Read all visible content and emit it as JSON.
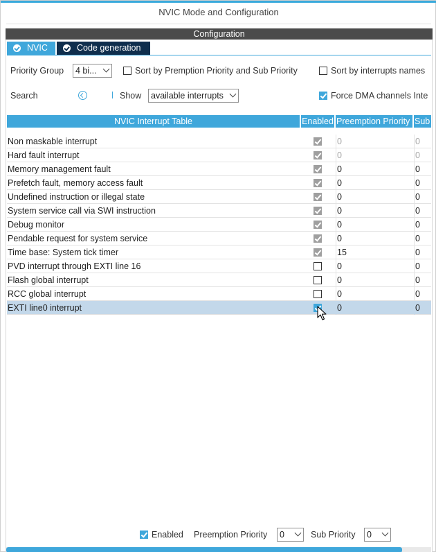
{
  "window": {
    "title": "NVIC Mode and Configuration"
  },
  "config_bar": {
    "label": "Configuration"
  },
  "tabs": [
    {
      "label": "NVIC",
      "icon": "check-circle-icon",
      "active": true
    },
    {
      "label": "Code generation",
      "icon": "check-circle-icon",
      "active": false
    }
  ],
  "toolbar": {
    "priority_group_label": "Priority Group",
    "priority_group_value": "4 bi...",
    "sort_preemption_label": "Sort by Premption Priority and Sub Priority",
    "sort_preemption_checked": false,
    "sort_interrupts_label": "Sort by interrupts names",
    "sort_interrupts_checked": false,
    "search_label": "Search",
    "show_label": "Show",
    "show_value": "available interrupts",
    "force_dma_label": "Force DMA channels Inte",
    "force_dma_checked": true
  },
  "table": {
    "headers": {
      "name": "NVIC Interrupt Table",
      "enabled": "Enabled",
      "preemption": "Preemption Priority",
      "sub": "Sub"
    },
    "rows": [
      {
        "name": "Non maskable interrupt",
        "enabled": true,
        "locked": true,
        "preemption": "0",
        "sub": "0",
        "muted": true
      },
      {
        "name": "Hard fault interrupt",
        "enabled": true,
        "locked": true,
        "preemption": "0",
        "sub": "0",
        "muted": true
      },
      {
        "name": "Memory management fault",
        "enabled": true,
        "locked": true,
        "preemption": "0",
        "sub": "0"
      },
      {
        "name": "Prefetch fault, memory access fault",
        "enabled": true,
        "locked": true,
        "preemption": "0",
        "sub": "0"
      },
      {
        "name": "Undefined instruction or illegal state",
        "enabled": true,
        "locked": true,
        "preemption": "0",
        "sub": "0"
      },
      {
        "name": "System service call via SWI instruction",
        "enabled": true,
        "locked": true,
        "preemption": "0",
        "sub": "0"
      },
      {
        "name": "Debug monitor",
        "enabled": true,
        "locked": true,
        "preemption": "0",
        "sub": "0"
      },
      {
        "name": "Pendable request for system service",
        "enabled": true,
        "locked": true,
        "preemption": "0",
        "sub": "0"
      },
      {
        "name": "Time base: System tick timer",
        "enabled": true,
        "locked": true,
        "preemption": "15",
        "sub": "0"
      },
      {
        "name": "PVD interrupt through EXTI line 16",
        "enabled": false,
        "locked": false,
        "preemption": "0",
        "sub": "0"
      },
      {
        "name": "Flash global interrupt",
        "enabled": false,
        "locked": false,
        "preemption": "0",
        "sub": "0"
      },
      {
        "name": "RCC global interrupt",
        "enabled": false,
        "locked": false,
        "preemption": "0",
        "sub": "0"
      },
      {
        "name": "EXTI line0 interrupt",
        "enabled": true,
        "locked": false,
        "preemption": "0",
        "sub": "0",
        "selected": true
      }
    ]
  },
  "footer": {
    "enabled_label": "Enabled",
    "enabled_checked": true,
    "preemption_label": "Preemption Priority",
    "preemption_value": "0",
    "sub_label": "Sub Priority",
    "sub_value": "0"
  },
  "colors": {
    "accent": "#3fa7db",
    "dark_tab": "#0f2e4d",
    "selected_row": "#c3d8ea",
    "config_bar": "#4b4b4b"
  }
}
